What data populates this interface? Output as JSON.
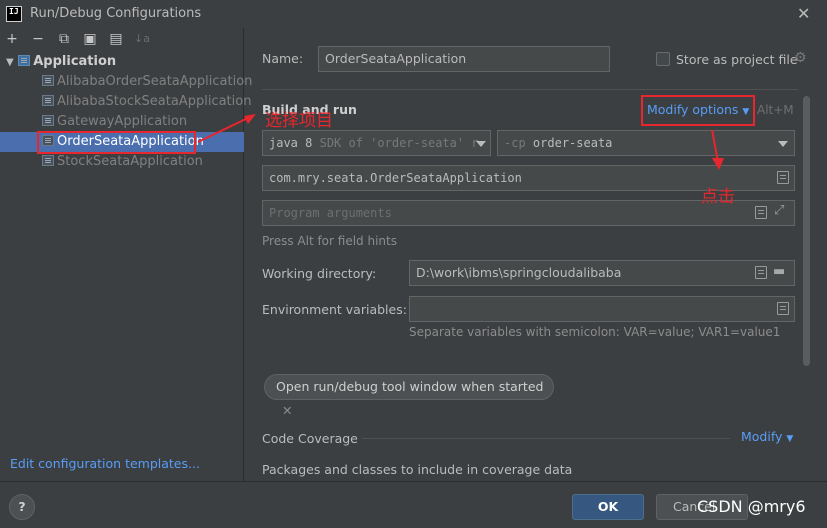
{
  "window": {
    "title": "Run/Debug Configurations",
    "app_icon_text": "IJ"
  },
  "toolbar": {
    "add": "+",
    "remove": "−",
    "copy": "⧉",
    "save": "▣",
    "folder": "▤",
    "sort": "↓a"
  },
  "tree": {
    "root_label": "Application",
    "items": [
      {
        "label": "AlibabaOrderSeataApplication"
      },
      {
        "label": "AlibabaStockSeataApplication"
      },
      {
        "label": "GatewayApplication"
      },
      {
        "label": "OrderSeataApplication"
      },
      {
        "label": "StockSeataApplication"
      }
    ],
    "selected_index": 3,
    "edit_templates_link": "Edit configuration templates..."
  },
  "form": {
    "name_label": "Name:",
    "name_value": "OrderSeataApplication",
    "store_label": "Store as project file",
    "build_run_label": "Build and run",
    "modify_options_label": "Modify options",
    "modify_options_shortcut": "Alt+M",
    "jre_value_main": "java 8",
    "jre_value_dim": "SDK of 'order-seata' r",
    "cp_prefix": "-cp",
    "cp_value": "order-seata",
    "main_class_value": "com.mry.seata.OrderSeataApplication",
    "program_args_placeholder": "Program arguments",
    "field_hint": "Press Alt for field hints",
    "working_dir_label": "Working directory:",
    "working_dir_value": "D:\\work\\ibms\\springcloudalibaba",
    "env_vars_label": "Environment variables:",
    "env_vars_value": "",
    "env_vars_hint": "Separate variables with semicolon: VAR=value; VAR1=value1",
    "chip_label": "Open run/debug tool window when started",
    "code_coverage_label": "Code Coverage",
    "code_coverage_modify": "Modify",
    "packages_label": "Packages and classes to include in coverage data"
  },
  "buttons": {
    "help": "?",
    "ok": "OK",
    "cancel": "Cancel"
  },
  "annotations": {
    "select_item": "选择项目",
    "click": "点击",
    "color": "#e8262d"
  },
  "watermark": "CSDN @mry6"
}
